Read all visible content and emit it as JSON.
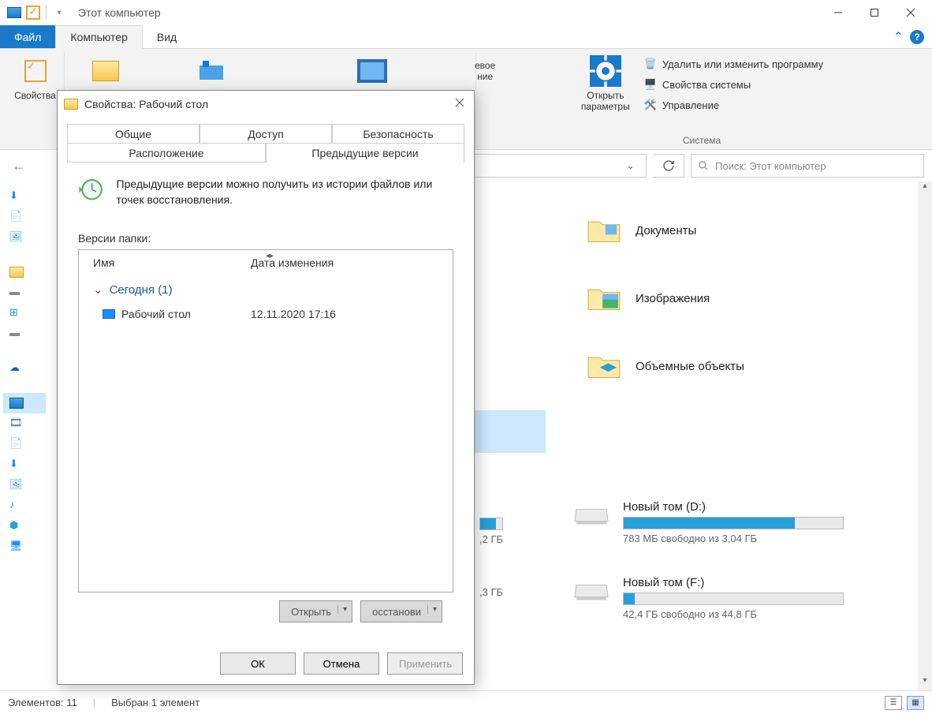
{
  "titlebar": {
    "title": "Этот компьютер"
  },
  "tabs": {
    "file": "Файл",
    "computer": "Компьютер",
    "view": "Вид"
  },
  "ribbon": {
    "properties": "Свойства",
    "open_params": "Открыть\nпараметры",
    "delete_program": "Удалить или изменить программу",
    "system_props": "Свойства системы",
    "management": "Управление",
    "group_system": "Система",
    "partial_right": "евое\nние"
  },
  "nav": {
    "search_placeholder": "Поиск: Этот компьютер"
  },
  "folders": {
    "documents": "Документы",
    "images": "Изображения",
    "objects3d": "Объемные объекты"
  },
  "drives": {
    "partial1_free": ",2 ГБ",
    "partial2_free": ",3 ГБ",
    "d": {
      "name": "Новый том (D:)",
      "free": "783 МБ свободно из 3,04 ГБ",
      "pct": 78
    },
    "f": {
      "name": "Новый том (F:)",
      "free": "42,4 ГБ свободно из 44,8 ГБ",
      "pct": 5
    }
  },
  "status": {
    "items": "Элементов: 11",
    "selected": "Выбран 1 элемент"
  },
  "dialog": {
    "title": "Свойства: Рабочий стол",
    "tabs": {
      "general": "Общие",
      "access": "Доступ",
      "security": "Безопасность",
      "location": "Расположение",
      "previous": "Предыдущие версии"
    },
    "desc": "Предыдущие версии можно получить из истории файлов или точек восстановления.",
    "versions_label": "Версии папки:",
    "col_name": "Имя",
    "col_date": "Дата изменения",
    "group_today": "Сегодня (1)",
    "item_name": "Рабочий стол",
    "item_date": "12.11.2020 17:16",
    "btn_open": "Открыть",
    "btn_restore": "осстанови",
    "btn_ok": "ОК",
    "btn_cancel": "Отмена",
    "btn_apply": "Применить"
  }
}
